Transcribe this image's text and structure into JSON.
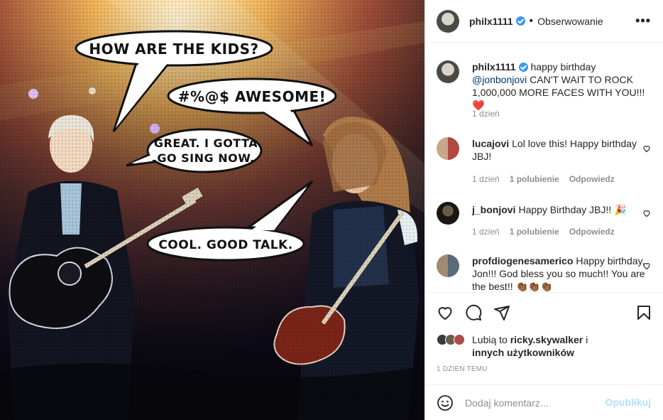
{
  "post_image": {
    "bubbles": {
      "bubble1": "HOW ARE THE KIDS?",
      "bubble2": "#%@$ AWESOME!",
      "bubble3_line1": "GREAT. I GOTTA",
      "bubble3_line2": "GO SING NOW.",
      "bubble4": "COOL. GOOD TALK."
    }
  },
  "header": {
    "username": "philx1111",
    "dot": "•",
    "follow_label": "Obserwowanie",
    "more_label": "•••"
  },
  "caption": {
    "username": "philx1111",
    "text_before": "happy birthday ",
    "mention": "@jonbonjovi",
    "text_after": " CAN'T WAIT TO ROCK 1,000,000 MORE FACES WITH YOU!!!",
    "heart_emoji": "❤️",
    "time": "1 dzień"
  },
  "comments": [
    {
      "username": "lucajovi",
      "text": "Lol love this! Happy birthday JBJ!",
      "time": "1 dzień",
      "likes": "1 polubienie",
      "reply": "Odpowiedz"
    },
    {
      "username": "j_bonjovi",
      "text": "Happy Birthday JBJ!! 🎉",
      "time": "1 dzień",
      "likes": "1 polubienie",
      "reply": "Odpowiedz"
    },
    {
      "username": "profdiogenesamerico",
      "text": "Happy birthday, Jon!!! God bless you so much!! You are the best!! 👏🏾👏🏾👏🏾"
    }
  ],
  "likes": {
    "prefix": "Lubią to ",
    "user": "ricky.skywalker",
    "middle": " i",
    "others": "innych użytkowników"
  },
  "date_label": "1 DZIEŃ TEMU",
  "composer": {
    "placeholder": "Dodaj komentarz...",
    "post_label": "Opublikuj"
  },
  "colors": {
    "verified": "#3897f0",
    "link": "#00376b",
    "muted": "#8e8e8e",
    "post_disabled": "#b2dffc"
  }
}
